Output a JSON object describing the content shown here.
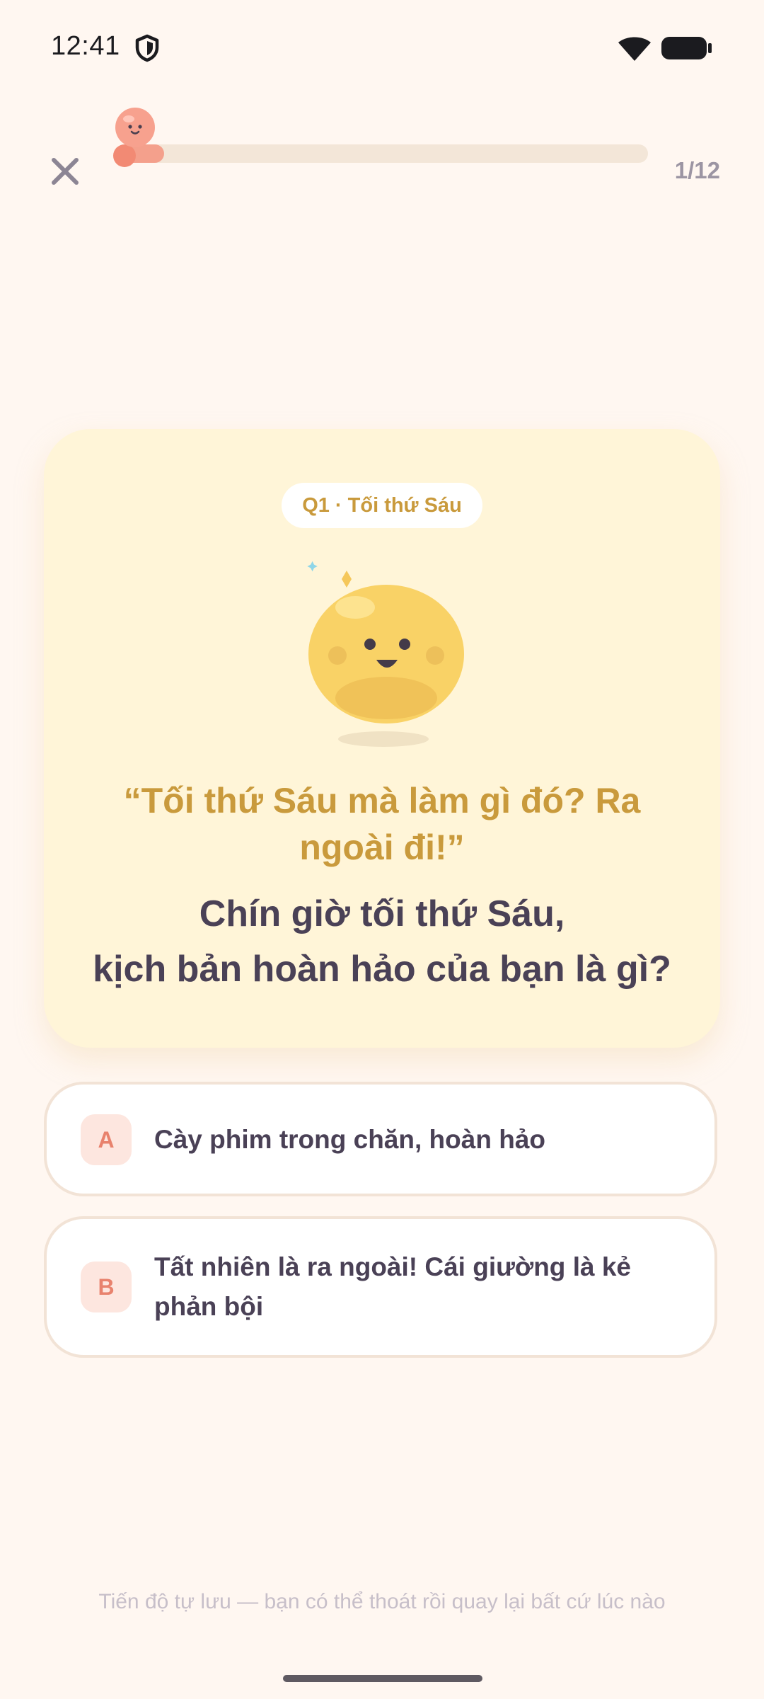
{
  "status_bar": {
    "time": "12:41",
    "icons": [
      "shield-icon",
      "wifi-icon",
      "battery-icon"
    ]
  },
  "header": {
    "close_icon": "close-icon",
    "progress_label": "1/12",
    "progress_fraction": 0.0833,
    "colors": {
      "track": "#f3e6d8",
      "fill": "#f4a08c",
      "dot": "#f28a74"
    }
  },
  "question": {
    "badge": "Q1 · Tối thứ Sáu",
    "quote": "“Tối thứ Sáu mà làm gì đó? Ra ngoài đi!”",
    "title_line1": "Chín giờ tối thứ Sáu,",
    "title_line2": "kịch bản hoàn hảo của bạn là gì?",
    "colors": {
      "card_bg": "#fff5d8",
      "accent": "#c99a3c",
      "text": "#4a4156"
    }
  },
  "options": [
    {
      "letter": "A",
      "text": "Cày phim trong chăn, hoàn hảo"
    },
    {
      "letter": "B",
      "text": "Tất nhiên là ra ngoài! Cái giường là kẻ phản bội"
    }
  ],
  "footer": {
    "note": "Tiến độ tự lưu — bạn có thể thoát rồi quay lại bất cứ lúc nào"
  }
}
